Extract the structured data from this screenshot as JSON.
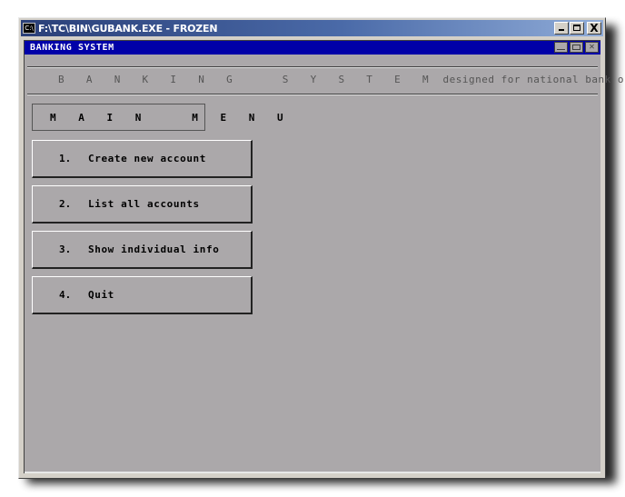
{
  "window": {
    "title": "F:\\TC\\BIN\\GUBANK.EXE - FROZEN",
    "icon": "console-icon",
    "icon_text": "C:\\",
    "controls": {
      "minimize": "_",
      "maximize": "□",
      "close": "X"
    }
  },
  "dos_window": {
    "title": "BANKING SYSTEM",
    "controls": {
      "minimize": "_",
      "maximize": "□",
      "close": "✕"
    }
  },
  "banner": {
    "title": "BANKING SYSTEM",
    "title_spaced": "B A N K I N G   S Y S T E M",
    "subtitle": "designed for national bank of pakistan"
  },
  "main_menu": {
    "heading": "MAIN MENU",
    "heading_spaced": "M A I N   M E N U",
    "items": [
      {
        "number": "1.",
        "label": "Create new account"
      },
      {
        "number": "2.",
        "label": "List all accounts"
      },
      {
        "number": "3.",
        "label": "Show individual info"
      },
      {
        "number": "4.",
        "label": "Quit"
      }
    ]
  },
  "colors": {
    "screen_bg": "#aba8aa",
    "dos_titlebar": "#0000a8",
    "text_dim": "#555555",
    "text": "#000000"
  }
}
